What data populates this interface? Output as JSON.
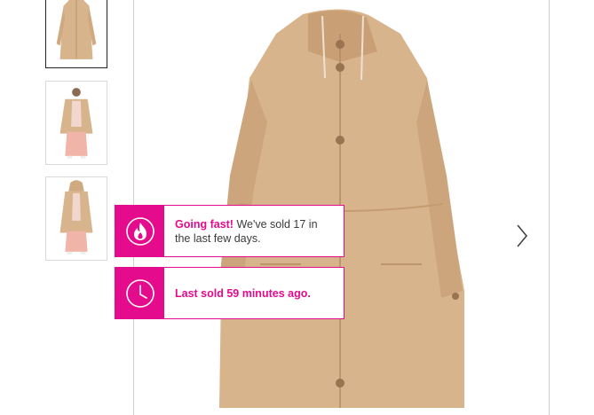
{
  "gallery": {
    "thumbnails": [
      {
        "alt": "coat-front-thumbnail"
      },
      {
        "alt": "coat-open-on-model-thumbnail"
      },
      {
        "alt": "coat-hood-up-on-model-thumbnail"
      }
    ],
    "active_index": 0
  },
  "notices": {
    "going_fast": {
      "headline": "Going fast!",
      "message": " We've sold 17 in the last few days.",
      "icon": "flame-icon"
    },
    "last_sold": {
      "headline": "Last sold 59 minutes ago.",
      "icon": "clock-icon"
    }
  },
  "colors": {
    "accent": "#e40b8d",
    "coat": "#d8b48d",
    "coat_shadow": "#c49c72"
  }
}
